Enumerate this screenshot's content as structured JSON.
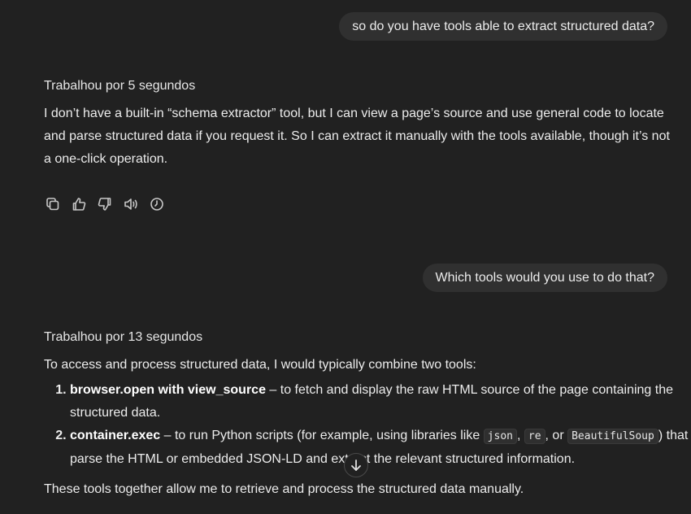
{
  "messages": {
    "user1": "so do you have tools able to extract structured data?",
    "status1": "Trabalhou por 5 segundos",
    "reply1": "I don’t have a built-in “schema extractor” tool, but I can view a page’s source and use general code to locate and parse structured data if you request it. So I can extract it manually with the tools available, though it’s not a one-click operation.",
    "user2": "Which tools would you use to do that?",
    "status2": "Trabalhou por 13 segundos",
    "reply2_intro": "To access and process structured data, I would typically combine two tools:",
    "steps": [
      {
        "tool": "browser.open with view_source",
        "desc": " – to fetch and display the raw HTML source of the page containing the structured data."
      },
      {
        "tool": "container.exec",
        "desc_a": " – to run Python scripts (for example, using libraries like ",
        "code1": "json",
        "sep1": ", ",
        "code2": "re",
        "sep2": ", or ",
        "code3": "BeautifulSoup",
        "desc_b": ") that parse the HTML or embedded JSON-LD and extract the relevant structured information."
      }
    ],
    "reply2_outro": "These tools together allow me to retrieve and process the structured data manually."
  },
  "actions": {
    "icons": [
      "copy-icon",
      "thumbs-up-icon",
      "thumbs-down-icon",
      "read-aloud-icon",
      "history-icon"
    ]
  },
  "scroll": {
    "icon": "arrow-down-icon"
  }
}
